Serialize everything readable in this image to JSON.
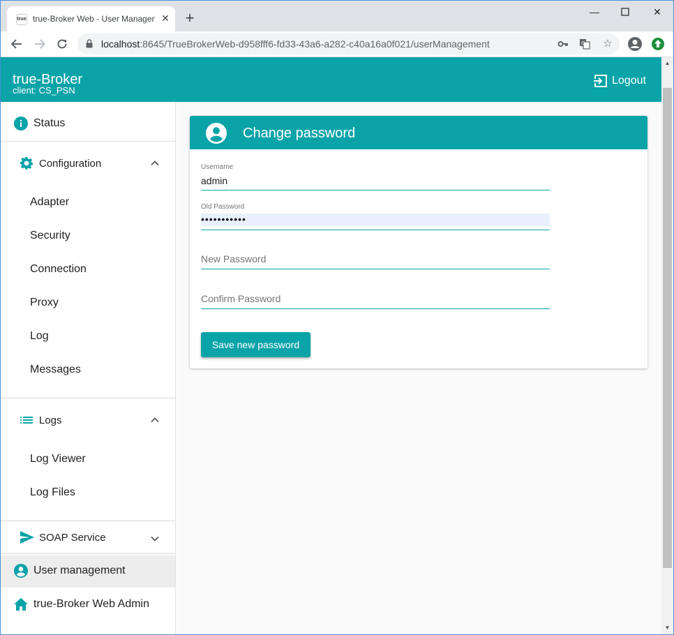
{
  "browser": {
    "tab_title": "true-Broker Web - User Management",
    "favicon_text": "true",
    "url_host": "localhost",
    "url_rest": ":8645/TrueBrokerWeb-d958fff6-fd33-43a6-a282-c40a16a0f021/userManagement"
  },
  "header": {
    "title": "true-Broker",
    "subtitle": "client: CS_PSN",
    "logout_label": "Logout"
  },
  "sidebar": {
    "status": "Status",
    "configuration": {
      "label": "Configuration",
      "items": [
        "Adapter",
        "Security",
        "Connection",
        "Proxy",
        "Log",
        "Messages"
      ]
    },
    "logs": {
      "label": "Logs",
      "items": [
        "Log Viewer",
        "Log Files"
      ]
    },
    "soap": "SOAP Service",
    "user_management": "User management",
    "web_admin": "true-Broker Web Admin"
  },
  "form": {
    "title": "Change password",
    "username_label": "Username",
    "username_value": "admin",
    "old_password_label": "Old Password",
    "old_password_value": "•••••••••••",
    "new_password_placeholder": "New Password",
    "confirm_password_placeholder": "Confirm Password",
    "save_label": "Save new password"
  },
  "colors": {
    "accent": "#0aa3a8",
    "active_bg": "#ededed"
  }
}
